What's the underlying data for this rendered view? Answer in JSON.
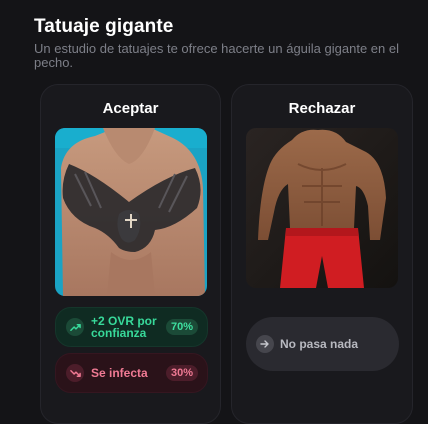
{
  "header": {
    "title": "Tatuaje gigante",
    "subtitle": "Un estudio de tatuajes te ofrece hacerte un águila gigante en el pecho."
  },
  "accept": {
    "title": "Aceptar",
    "outcomes": [
      {
        "label": "+2 OVR por confianza",
        "chance": "70%",
        "icon": "trend-up-icon",
        "color": "#38d99a"
      },
      {
        "label": "Se infecta",
        "chance": "30%",
        "icon": "trend-down-icon",
        "color": "#f07a94"
      }
    ]
  },
  "reject": {
    "title": "Rechazar",
    "outcome": {
      "label": "No pasa nada",
      "icon": "arrow-right-icon"
    }
  },
  "colors": {
    "background": "#141417",
    "card": "#19191d",
    "positive": "#38d99a",
    "negative": "#f07a94"
  }
}
